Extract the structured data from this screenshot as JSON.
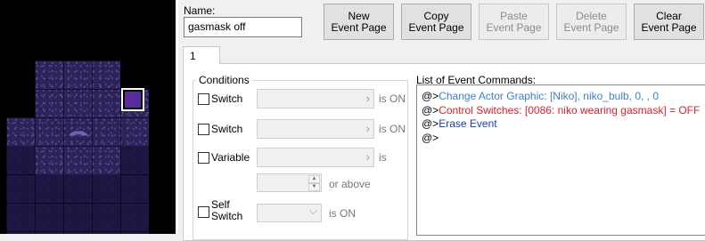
{
  "event": {
    "name_label": "Name:",
    "name_value": "gasmask off"
  },
  "toolbar": {
    "new_label": "New\nEvent Page",
    "copy_label": "Copy\nEvent Page",
    "paste_label": "Paste\nEvent Page",
    "delete_label": "Delete\nEvent Page",
    "clear_label": "Clear\nEvent Page"
  },
  "tabs": [
    {
      "label": "1"
    }
  ],
  "conditions": {
    "title": "Conditions",
    "switch1_label": "Switch",
    "switch1_suffix": "is ON",
    "switch2_label": "Switch",
    "switch2_suffix": "is ON",
    "variable_label": "Variable",
    "variable_suffix": "is",
    "above_suffix": "or above",
    "self_switch_label": "Self\nSwitch",
    "self_switch_suffix": "is ON",
    "combo_arrow": "›",
    "dropdown_arrow": "⌵"
  },
  "commands": {
    "title": "List of Event Commands:",
    "items": [
      {
        "prefix": "@>",
        "text": "Change Actor Graphic: [Niko], niko_bulb, 0, , 0",
        "color": "#3b7fd6"
      },
      {
        "prefix": "@>",
        "text": "Control Switches: [0086: niko wearing gasmask] = OFF",
        "color": "#e0202a"
      },
      {
        "prefix": "@>",
        "text": "Erase Event",
        "color": "#1a3fbf"
      },
      {
        "prefix": "@>",
        "text": "",
        "color": "#000000"
      }
    ]
  },
  "colors": {
    "map_tile": "#2a2459",
    "selected_event": "#5a2b9a"
  }
}
